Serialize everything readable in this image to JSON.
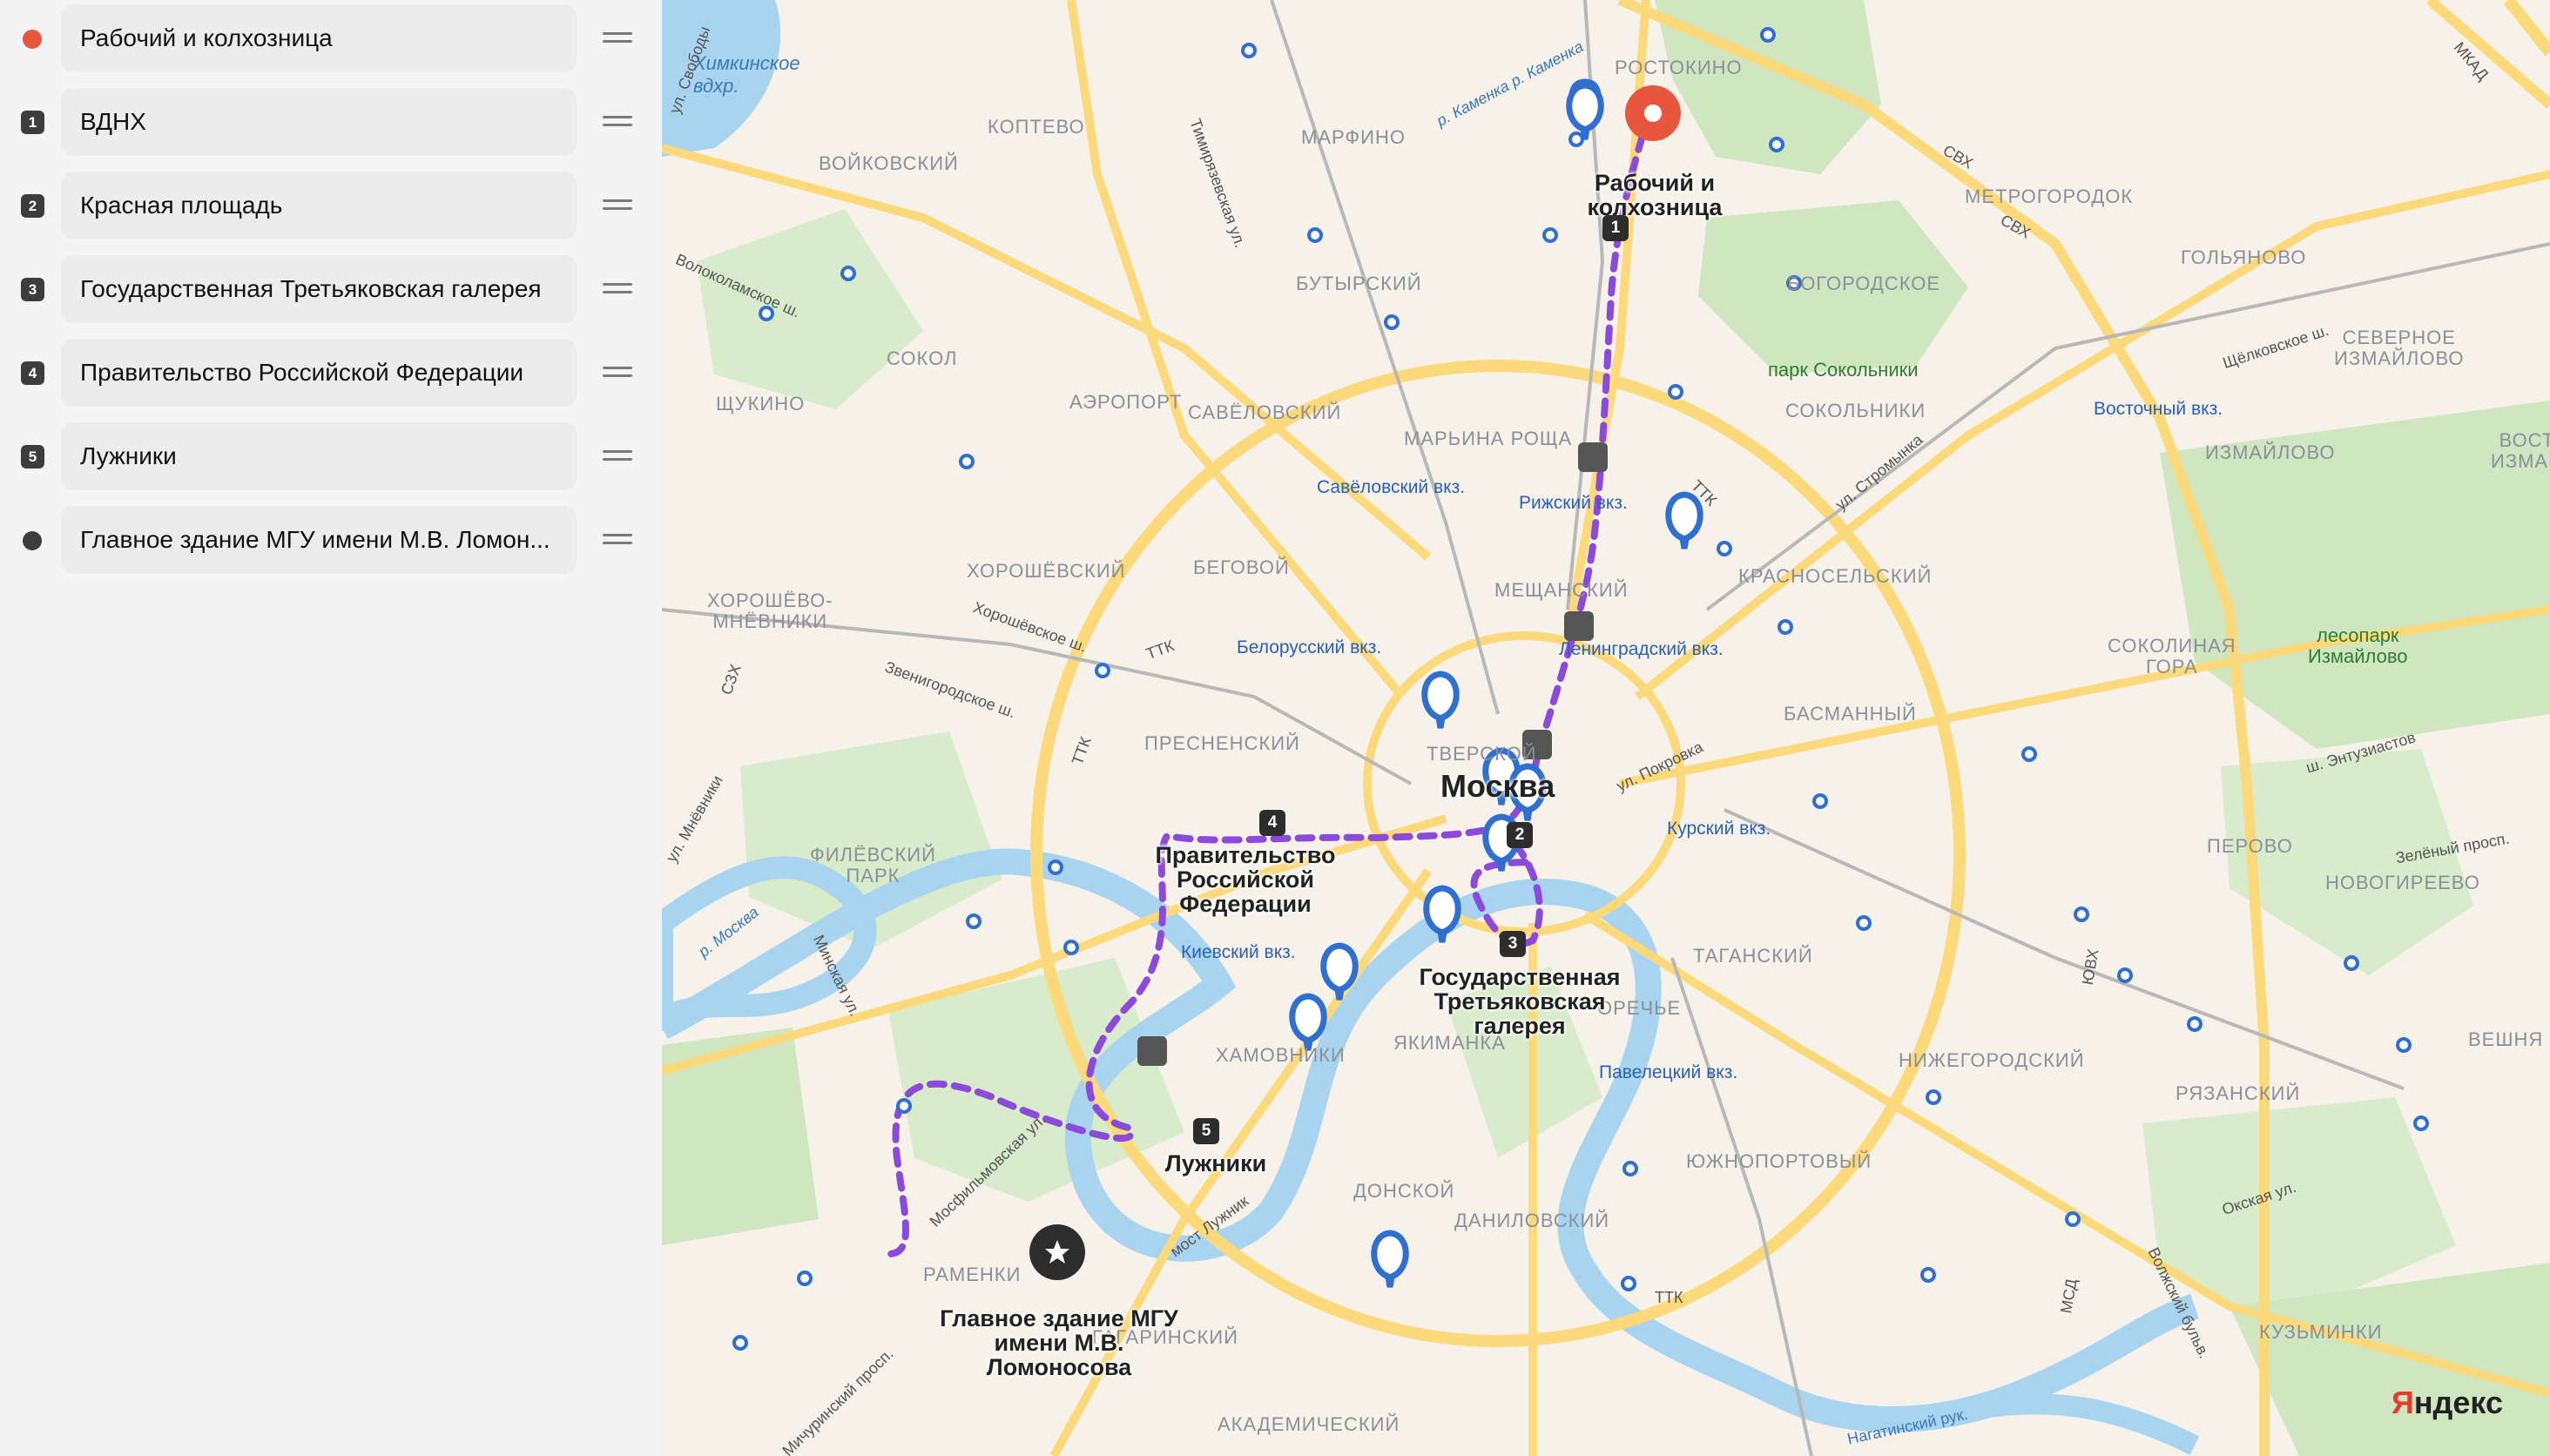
{
  "sidebar": {
    "items": [
      {
        "marker": "dot",
        "color": "#e8573d",
        "label": "Рабочий и колхозница"
      },
      {
        "marker": "num",
        "num": "1",
        "label": "ВДНХ"
      },
      {
        "marker": "num",
        "num": "2",
        "label": "Красная площадь"
      },
      {
        "marker": "num",
        "num": "3",
        "label": "Государственная Третьяковская галерея"
      },
      {
        "marker": "num",
        "num": "4",
        "label": "Правительство Российской Федерации"
      },
      {
        "marker": "num",
        "num": "5",
        "label": "Лужники"
      },
      {
        "marker": "dot",
        "color": "#3d3d3d",
        "label": "Главное здание МГУ имени М.В. Ломон..."
      }
    ]
  },
  "map": {
    "route_color": "#8b4ad9",
    "start_pin_color": "#e8573d",
    "end_pin_color": "#2d2d2d",
    "city": "Москва",
    "stop_labels": {
      "start": "Рабочий и\nколхозница",
      "government": "Правительство\nРоссийской\nФедерации",
      "tretyakov": "Государственная\nТретьяковская\nгалерея",
      "luzhniki": "Лужники",
      "msu": "Главное здание МГУ\nимени М.В.\nЛомоносова"
    },
    "route_badges": {
      "b1": "1",
      "b2": "2",
      "b3": "3",
      "b4": "4",
      "b5": "5"
    },
    "districts": {
      "rostokino": "РОСТОКИНО",
      "marfino": "МАРФИНО",
      "koptevo": "КОПТЕВО",
      "voykovsky": "ВОЙКОВСКИЙ",
      "metrogorodok": "МЕТРОГОРОДОК",
      "golyanovo": "ГОЛЬЯНОВО",
      "butyrsky": "БУТЫРСКИЙ",
      "bogorodskoe": "БОГОРОДСКОЕ",
      "sokol": "СОКОЛ",
      "aeroport": "АЭРОПОРТ",
      "shchukino": "ЩУКИНО",
      "savelovsky": "САВЁЛОВСКИЙ",
      "maryina": "МАРЬИНА РОЩА",
      "sokolniki": "СОКОЛЬНИКИ",
      "izmaylovo": "ИЗМАЙЛОВО",
      "sev_izmaylovo": "СЕВЕРНОЕ\nИЗМАЙЛОВО",
      "vost": "ВОСТ\nИЗМАЙ",
      "khoroshevsky": "ХОРОШЁВСКИЙ",
      "begovoy": "БЕГОВОЙ",
      "meshchansky": "МЕЩАНСКИЙ",
      "krasnoselsky": "КРАСНОСЕЛЬСКИЙ",
      "khoroshevo": "ХОРОШЁВО-\nМНЁВНИКИ",
      "sokolinaya": "СОКОЛИНАЯ\nГОРА",
      "basmanny": "БАСМАННЫЙ",
      "tverskoy": "ТВЕРСКОЙ",
      "presnensky": "ПРЕСНЕНСКИЙ",
      "perovo": "ПЕРОВО",
      "filevsky": "ФИЛЁВСКИЙ\nПАРК",
      "novogireevo": "НОВОГИРЕЕВО",
      "tagansky": "ТАГАНСКИЙ",
      "veshnyaki": "ВЕШНЯ",
      "zamoskvorechye": "ОРЕЧЬЕ",
      "yakimanka": "ЯКИМАНКА",
      "khamovniki": "ХАМОВНИКИ",
      "nizhegorodsky": "НИЖЕГОРОДСКИЙ",
      "ryazansky": "РЯЗАНСКИЙ",
      "yuzhnoportovy": "ЮЖНОПОРТОВЫЙ",
      "donskoy": "ДОНСКОЙ",
      "danilovsky": "ДАНИЛОВСКИЙ",
      "ramenki": "РАМЕНКИ",
      "gagarinsky": "ГАГАРИНСКИЙ",
      "akademichesky": "АКАДЕМИЧЕСКИЙ",
      "kuzminki": "КУЗЬМИНКИ"
    },
    "stations": {
      "savelovsky": "Савёловский вкз.",
      "rizhsky": "Рижский вкз.",
      "leningradsky": "Ленинградский вкз.",
      "belorussky": "Белорусский вкз.",
      "kursky": "Курский вкз.",
      "kievsky": "Киевский вкз.",
      "paveletsky": "Павелецкий вкз.",
      "vostochny": "Восточный вкз."
    },
    "pois": {
      "sokolniki_park": "парк Сокольники",
      "izmaylovo_park": "лесопарк\nИзмайлово"
    },
    "water": {
      "khimki": "Химкинское\nвдхр.",
      "moskva": "р. Москва",
      "kamenka": "р. Каменка р. Каменка"
    },
    "streets": {
      "mkad": "МКАД",
      "svh1": "СВХ",
      "svh2": "СВХ",
      "volokolamskoe": "Волоколамское ш.",
      "timiryazevskaya": "Тимирязевская ул.",
      "ttk1": "ТТК",
      "ttk2": "ТТК",
      "ttk3": "ТТК",
      "ttk4": "ТТК",
      "shchelkovskoe": "Щёлковское ш.",
      "stromynka": "ул. Стромынка",
      "zvenigorodskoe": "Звенигородское ш.",
      "khoroshevskoe": "Хорошёвское ш.",
      "pokrovka": "ул. Покровка",
      "entuziastov": "ш. Энтузиастов",
      "zeleny": "Зелёный просп.",
      "minskaya": "Минская ул.",
      "mosfilmovskaya": "Мосфильмовская ул.",
      "most_luzhnika": "мост Лужник",
      "okskaya": "Окская ул.",
      "michurinsky": "Мичуринский просп.",
      "volzhsky": "Волжский бульв.",
      "nagatinsky": "Нагатинский рук.",
      "ul_svobody": "ул. Свободы",
      "mnevniki": "ул. Мнёвники",
      "szkh": "СЗХ",
      "yuvkh": "ЮВХ",
      "mtsd": "МСД"
    },
    "logo_a": "Я",
    "logo_b": "ндекс"
  }
}
